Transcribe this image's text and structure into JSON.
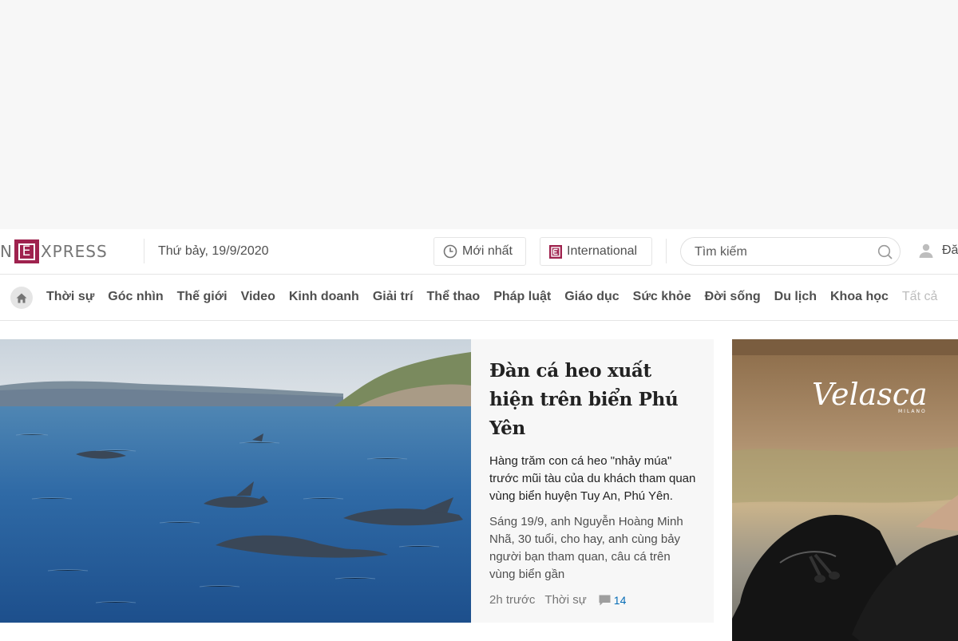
{
  "header": {
    "logo_prefix": "N",
    "logo_box": "E",
    "logo_suffix": "XPRESS",
    "date": "Thứ bảy, 19/9/2020",
    "latest_label": "Mới nhất",
    "international_label": "International",
    "search_placeholder": "Tìm kiếm",
    "login_label": "Đă"
  },
  "nav": {
    "items": [
      {
        "label": "Thời sự"
      },
      {
        "label": "Góc nhìn"
      },
      {
        "label": "Thế giới"
      },
      {
        "label": "Video"
      },
      {
        "label": "Kinh doanh"
      },
      {
        "label": "Giải trí"
      },
      {
        "label": "Thể thao"
      },
      {
        "label": "Pháp luật"
      },
      {
        "label": "Giáo dục"
      },
      {
        "label": "Sức khỏe"
      },
      {
        "label": "Đời sống"
      },
      {
        "label": "Du lịch"
      },
      {
        "label": "Khoa học"
      }
    ],
    "all_label": "Tất cả"
  },
  "hero": {
    "title": "Đàn cá heo xuất hiện trên biển Phú Yên",
    "description": "Hàng trăm con cá heo \"nhảy múa\" trước mũi tàu của du khách tham quan vùng biển huyện Tuy An, Phú Yên.",
    "body": "Sáng 19/9, anh Nguyễn Hoàng Minh Nhã, 30 tuổi, cho hay, anh cùng bảy người bạn tham quan, câu cá trên vùng biển gần",
    "time": "2h trước",
    "category": "Thời sự",
    "comments": "14"
  },
  "ad": {
    "brand": "Velasca",
    "brand_sub": "MILANO"
  },
  "colors": {
    "brand": "#9f224e",
    "link": "#076db6",
    "card_bg": "#f7f7f7"
  }
}
